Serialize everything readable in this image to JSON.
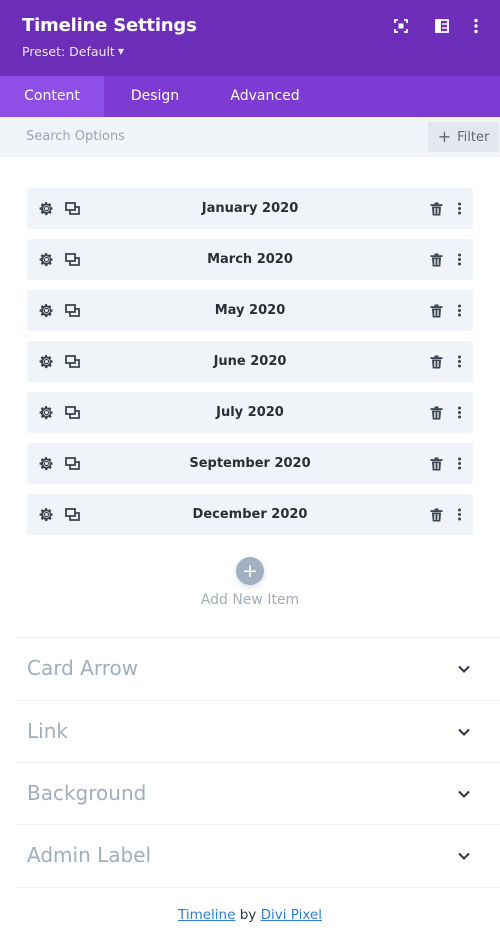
{
  "header": {
    "title": "Timeline Settings",
    "preset": "Preset: Default",
    "icons": [
      "fullscreen-icon",
      "split-view-icon",
      "more-vertical-icon"
    ]
  },
  "tabs": [
    {
      "label": "Content",
      "active": true
    },
    {
      "label": "Design",
      "active": false
    },
    {
      "label": "Advanced",
      "active": false
    }
  ],
  "search": {
    "placeholder": "Search Options"
  },
  "filter": {
    "label": "Filter"
  },
  "items": [
    {
      "label": "January 2020"
    },
    {
      "label": "March 2020"
    },
    {
      "label": "May 2020"
    },
    {
      "label": "June 2020"
    },
    {
      "label": "July 2020"
    },
    {
      "label": "September 2020"
    },
    {
      "label": "December 2020"
    }
  ],
  "add_item": {
    "label": "Add New Item"
  },
  "sections": [
    {
      "label": "Card Arrow"
    },
    {
      "label": "Link"
    },
    {
      "label": "Background"
    },
    {
      "label": "Admin Label"
    }
  ],
  "footer": {
    "module": "Timeline",
    "by": "by",
    "author": "Divi Pixel"
  },
  "colors": {
    "header_bg": "#6c2eb9",
    "tabs_bg": "#7d3bd3",
    "active_tab_bg": "#8f4ee8",
    "link": "#2e7fd9"
  }
}
